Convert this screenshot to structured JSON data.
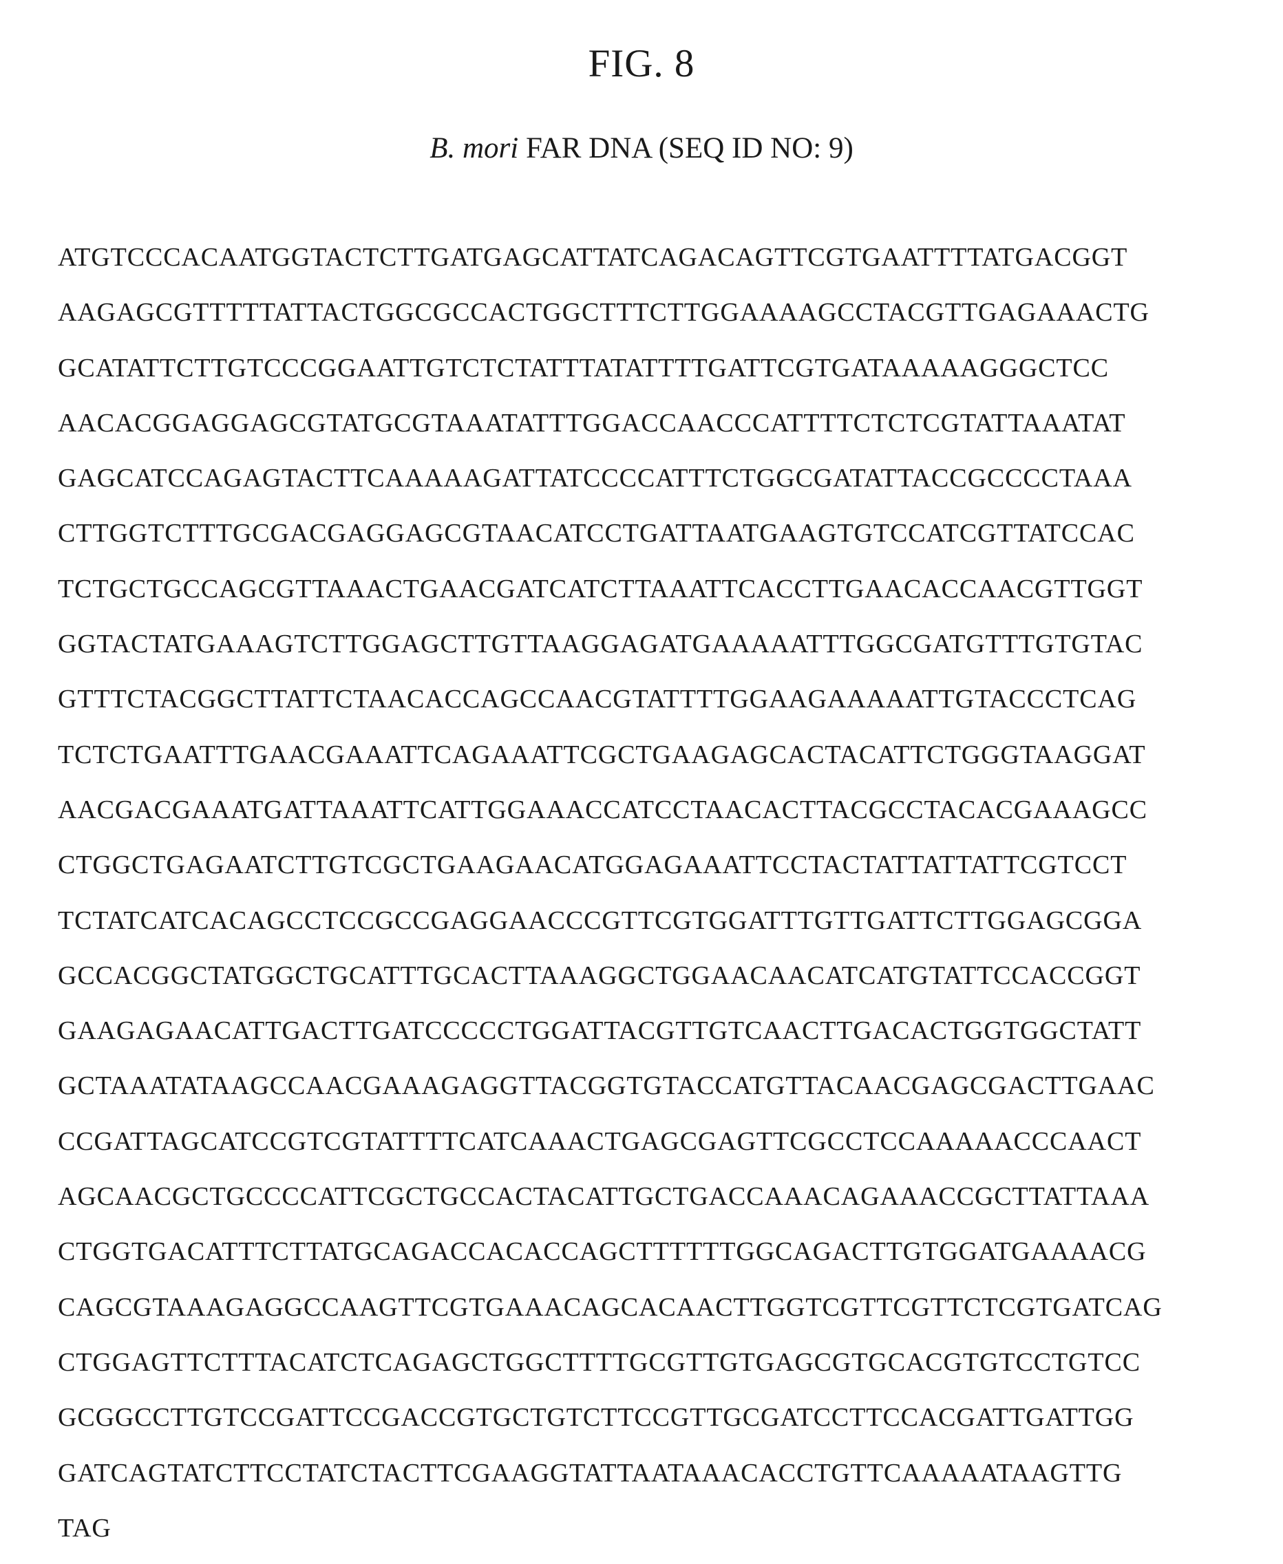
{
  "figure": {
    "title": "FIG. 8",
    "subtitle_italic": "B. mori",
    "subtitle_rest": "FAR DNA (SEQ ID NO: 9)"
  },
  "sequence_lines": [
    "ATGTCCCACAATGGTACTCTTGATGAGCATTATCAGACAGTTCGTGAATTTTATGACGGT",
    "AAGAGCGTTTTTATTACTGGCGCCACTGGCTTTCTTGGAAAAGCCTACGTTGAGAAACTG",
    "GCATATTCTTGTCCCGGAATTGTCTCTATTTATATTTTGATTCGTGATAAAAAGGGCTCC",
    "AACACGGAGGAGCGTATGCGTAAATATTTGGACCAACCCATTTTCTCTCGTATTAAATAT",
    "GAGCATCCAGAGTACTTCAAAAAGATTATCCCCATTTCTGGCGATATTACCGCCCCTAAA",
    "CTTGGTCTTTGCGACGAGGAGCGTAACATCCTGATTAATGAAGTGTCCATCGTTATCCAC",
    "TCTGCTGCCAGCGTTAAACTGAACGATCATCTTAAATTCACCTTGAACACCAACGTTGGT",
    "GGTACTATGAAAGTCTTGGAGCTTGTTAAGGAGATGAAAAATTTGGCGATGTTTGTGTAC",
    "GTTTCTACGGCTTATTCTAACACCAGCCAACGTATTTTGGAAGAAAAATTGTACCCTCAG",
    "TCTCTGAATTTGAACGAAATTCAGAAATTCGCTGAAGAGCACTACATTCTGGGTAAGGAT",
    "AACGACGAAATGATTAAATTCATTGGAAACCATCCTAACACTTACGCCTACACGAAAGCC",
    "CTGGCTGAGAATCTTGTCGCTGAAGAACATGGAGAAATTCCTACTATTATTATTCGTCCT",
    "TCTATCATCACAGCCTCCGCCGAGGAACCCGTTCGTGGATTTGTTGATTCTTGGAGCGGA",
    "GCCACGGCTATGGCTGCATTTGCACTTAAAGGCTGGAACAACATCATGTATTCCACCGGT",
    "GAAGAGAACATTGACTTGATCCCCCTGGATTACGTTGTCAACTTGACACTGGTGGCTATT",
    "GCTAAATATAAGCCAACGAAAGAGGTTACGGTGTACCATGTTACAACGAGCGACTTGAAC",
    "CCGATTAGCATCCGTCGTATTTTCATCAAACTGAGCGAGTTCGCCTCCAAAAACCCAACT",
    "AGCAACGCTGCCCCATTCGCTGCCACTACATTGCTGACCAAACAGAAACCGCTTATTAAA",
    "CTGGTGACATTTCTTATGCAGACCACACCAGCTTTTTTGGCAGACTTGTGGATGAAAACG",
    "CAGCGTAAAGAGGCCAAGTTCGTGAAACAGCACAACTTGGTCGTTCGTTCTCGTGATCAG",
    "CTGGAGTTCTTTACATCTCAGAGCTGGCTTTTGCGTTGTGAGCGTGCACGTGTCCTGTCC",
    "GCGGCCTTGTCCGATTCCGACCGTGCTGTCTTCCGTTGCGATCCTTCCACGATTGATTGG",
    "GATCAGTATCTTCCTATCTACTTCGAAGGTATTAATAAACACCTGTTCAAAAATAAGTTG",
    "TAG"
  ]
}
